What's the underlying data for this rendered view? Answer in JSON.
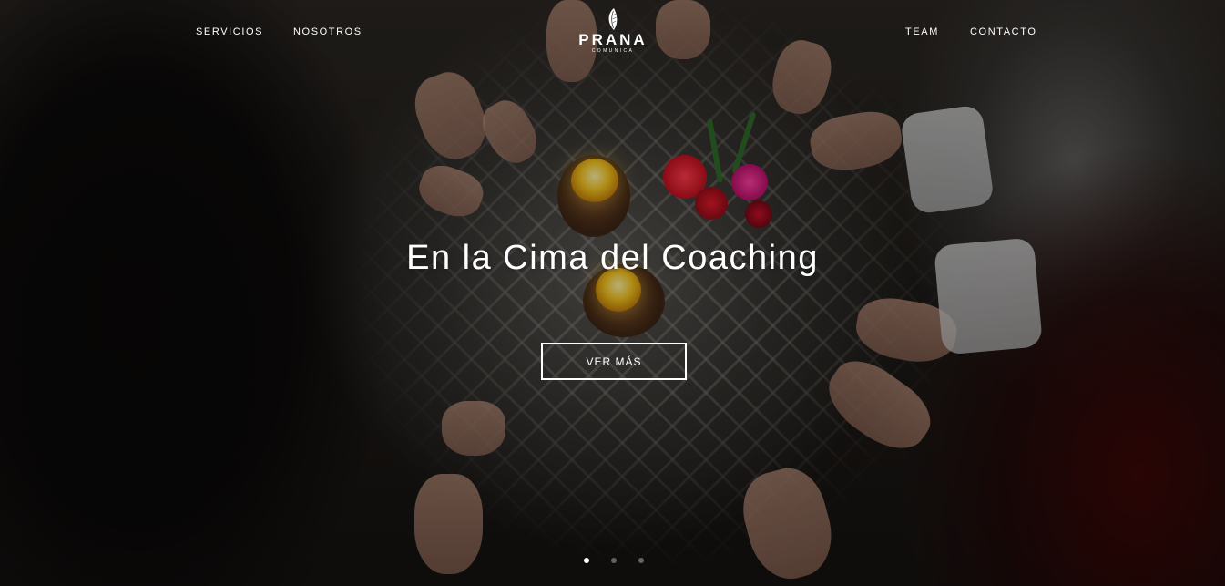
{
  "nav": {
    "left_links": [
      "SERVICIOS",
      "NOSOTROS"
    ],
    "right_links": [
      "TEAM",
      "CONTACTO"
    ],
    "logo": {
      "name": "PRANA",
      "tagline": "COMUNICA"
    }
  },
  "hero": {
    "headline": "En la Cima del Coaching",
    "cta_label": "VER MÁS"
  },
  "slider": {
    "slide_count": 3,
    "active_index": 0
  },
  "colors": {
    "text": "#ffffff",
    "cta_border": "#ffffff"
  }
}
